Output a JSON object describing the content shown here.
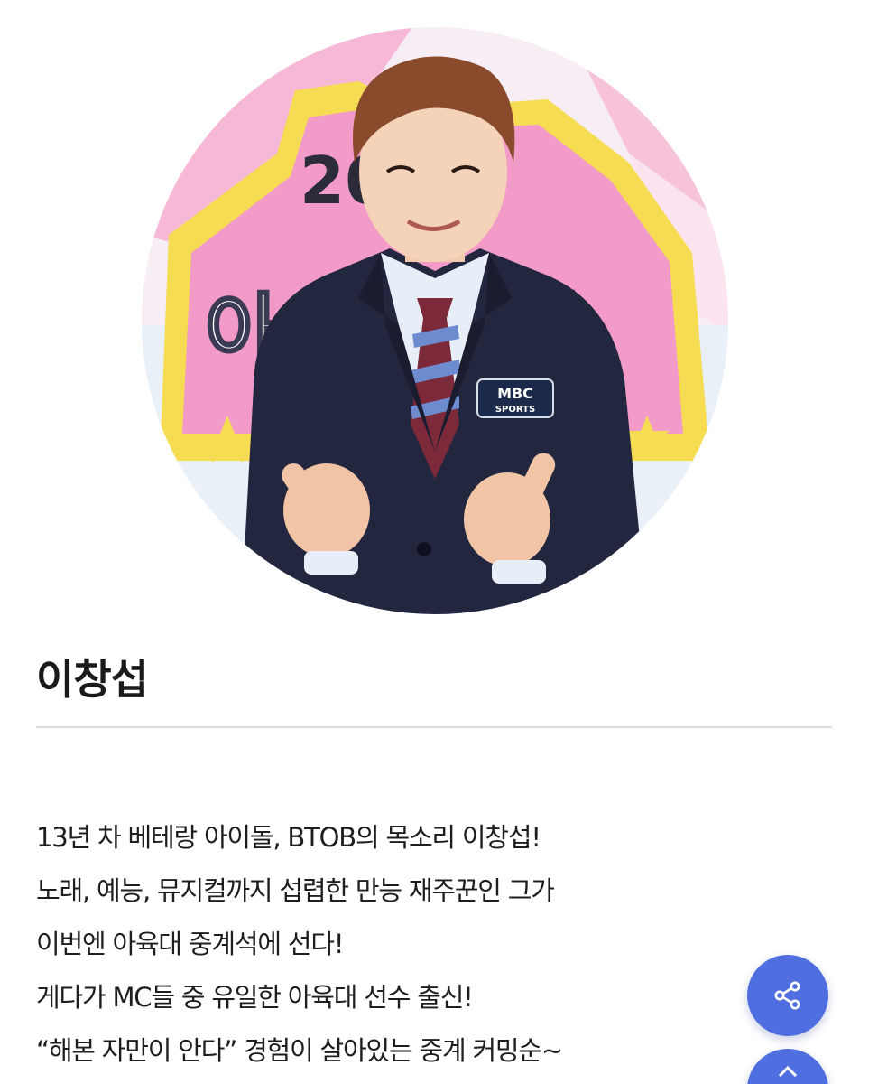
{
  "profile": {
    "name": "이창섭",
    "photo_icon": "profile-photo"
  },
  "description": {
    "lines": [
      "13년 차 베테랑 아이돌, BTOB의 목소리 이창섭!",
      "노래, 예능, 뮤지컬까지 섭렵한 만능 재주꾼인 그가",
      "이번엔 아육대 중계석에 선다!",
      "게다가 MC들 중 유일한 아육대 선수 출신!",
      "“해본 자만이 안다” 경험이 살아있는 중계 커밍순~"
    ]
  },
  "photo_overlay": {
    "year_text": "2025",
    "sign_text": "아이돌스타",
    "badge_top": "MBC",
    "badge_bottom": "SPORTS"
  },
  "colors": {
    "fab": "#4f6ee0",
    "suit": "#23263f",
    "sign_pink": "#f29bc9",
    "sign_yellow": "#f6dc52"
  },
  "floating_buttons": [
    {
      "icon": "share-icon"
    },
    {
      "icon": "up-arrow-icon"
    }
  ]
}
